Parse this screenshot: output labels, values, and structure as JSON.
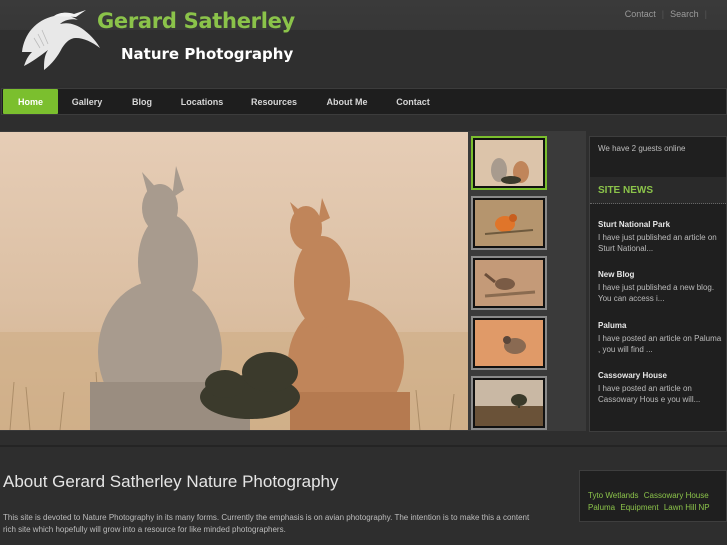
{
  "header": {
    "title": "Gerard Satherley",
    "subtitle": "Nature Photography",
    "top_links": [
      "Contact",
      "Search"
    ]
  },
  "nav": {
    "items": [
      "Home",
      "Gallery",
      "Blog",
      "Locations",
      "Resources",
      "About Me",
      "Contact"
    ],
    "active": "Home"
  },
  "gallery": {
    "main_image": "two-red-kangaroos-photo",
    "thumbnails": [
      "kangaroos-thumbnail",
      "orange-chat-thumbnail",
      "wren-thumbnail",
      "quail-thumbnail",
      "landscape-thumbnail"
    ],
    "active_thumbnail": 0
  },
  "sidebar": {
    "guests": "We have 2 guests online",
    "news_heading": "SITE NEWS",
    "news": [
      {
        "title": "Sturt National Park",
        "desc": "I have just published an article on Sturt National..."
      },
      {
        "title": "New Blog",
        "desc": "I have just published a new blog. You can access i..."
      },
      {
        "title": "Paluma",
        "desc": "I have posted an article on Paluma , you will find ..."
      },
      {
        "title": "Cassowary House",
        "desc": "I have posted an article on Cassowary Hous e you will..."
      }
    ]
  },
  "about": {
    "title": "About Gerard Satherley Nature Photography",
    "text": "This site is devoted to Nature Photography in its many forms. Currently the emphasis is on avian photography. The intention is to make this a content rich site which hopefully will grow into a resource for like minded photographers."
  },
  "tags": [
    "Tyto Wetlands",
    "Cassowary House",
    "Paluma",
    "Equipment",
    "Lawn Hill NP"
  ],
  "colors": {
    "accent": "#8bc34a",
    "nav_active": "#7bbf2e",
    "background": "#2e2e2e"
  }
}
